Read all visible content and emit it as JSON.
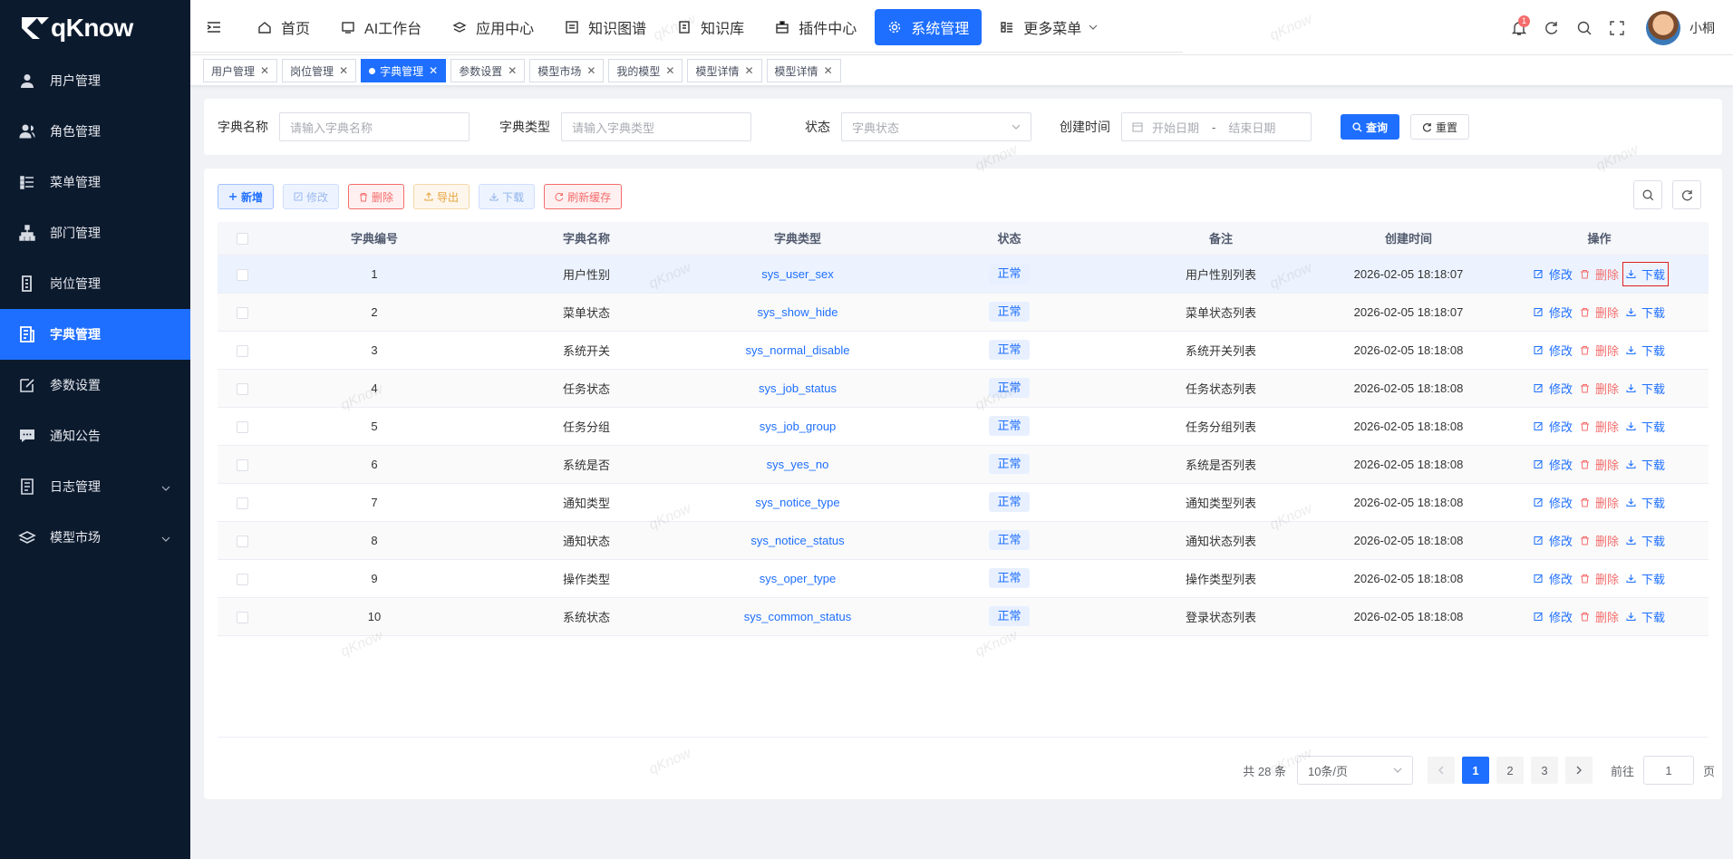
{
  "app": {
    "logo": "qKnow"
  },
  "sidebar": {
    "items": [
      {
        "label": "用户管理",
        "icon": "user-icon"
      },
      {
        "label": "角色管理",
        "icon": "role-icon"
      },
      {
        "label": "菜单管理",
        "icon": "menu-list-icon"
      },
      {
        "label": "部门管理",
        "icon": "org-tree-icon"
      },
      {
        "label": "岗位管理",
        "icon": "post-icon"
      },
      {
        "label": "字典管理",
        "icon": "dict-icon",
        "active": true
      },
      {
        "label": "参数设置",
        "icon": "edit-icon"
      },
      {
        "label": "通知公告",
        "icon": "message-icon"
      },
      {
        "label": "日志管理",
        "icon": "log-icon",
        "expandable": true
      },
      {
        "label": "模型市场",
        "icon": "model-icon",
        "expandable": true
      }
    ]
  },
  "topnav": {
    "items": [
      {
        "label": "首页",
        "icon": "home-icon"
      },
      {
        "label": "AI工作台",
        "icon": "ai-icon"
      },
      {
        "label": "应用中心",
        "icon": "app-icon"
      },
      {
        "label": "知识图谱",
        "icon": "graph-icon"
      },
      {
        "label": "知识库",
        "icon": "book-icon"
      },
      {
        "label": "插件中心",
        "icon": "plugin-icon"
      },
      {
        "label": "系统管理",
        "icon": "gear-icon",
        "active": true
      },
      {
        "label": "更多菜单",
        "icon": "more-icon"
      }
    ]
  },
  "header": {
    "notification_count": "1",
    "username": "小桐"
  },
  "tags": [
    {
      "label": "用户管理"
    },
    {
      "label": "岗位管理"
    },
    {
      "label": "字典管理",
      "active": true
    },
    {
      "label": "参数设置"
    },
    {
      "label": "模型市场"
    },
    {
      "label": "我的模型"
    },
    {
      "label": "模型详情"
    },
    {
      "label": "模型详情"
    }
  ],
  "search": {
    "dict_name_label": "字典名称",
    "dict_name_placeholder": "请输入字典名称",
    "dict_type_label": "字典类型",
    "dict_type_placeholder": "请输入字典类型",
    "status_label": "状态",
    "status_placeholder": "字典状态",
    "created_label": "创建时间",
    "start_placeholder": "开始日期",
    "range_sep": "-",
    "end_placeholder": "结束日期",
    "query_btn": "查询",
    "reset_btn": "重置"
  },
  "toolbar": {
    "add": "新增",
    "edit": "修改",
    "delete": "删除",
    "export": "导出",
    "download": "下载",
    "refresh_cache": "刷新缓存"
  },
  "table": {
    "columns": [
      "字典编号",
      "字典名称",
      "字典类型",
      "状态",
      "备注",
      "创建时间",
      "操作"
    ],
    "action_labels": {
      "edit": "修改",
      "delete": "删除",
      "download": "下载"
    },
    "rows": [
      {
        "id": "1",
        "name": "用户性别",
        "type": "sys_user_sex",
        "status": "正常",
        "remark": "用户性别列表",
        "created": "2026-02-05 18:18:07"
      },
      {
        "id": "2",
        "name": "菜单状态",
        "type": "sys_show_hide",
        "status": "正常",
        "remark": "菜单状态列表",
        "created": "2026-02-05 18:18:07"
      },
      {
        "id": "3",
        "name": "系统开关",
        "type": "sys_normal_disable",
        "status": "正常",
        "remark": "系统开关列表",
        "created": "2026-02-05 18:18:08"
      },
      {
        "id": "4",
        "name": "任务状态",
        "type": "sys_job_status",
        "status": "正常",
        "remark": "任务状态列表",
        "created": "2026-02-05 18:18:08"
      },
      {
        "id": "5",
        "name": "任务分组",
        "type": "sys_job_group",
        "status": "正常",
        "remark": "任务分组列表",
        "created": "2026-02-05 18:18:08"
      },
      {
        "id": "6",
        "name": "系统是否",
        "type": "sys_yes_no",
        "status": "正常",
        "remark": "系统是否列表",
        "created": "2026-02-05 18:18:08"
      },
      {
        "id": "7",
        "name": "通知类型",
        "type": "sys_notice_type",
        "status": "正常",
        "remark": "通知类型列表",
        "created": "2026-02-05 18:18:08"
      },
      {
        "id": "8",
        "name": "通知状态",
        "type": "sys_notice_status",
        "status": "正常",
        "remark": "通知状态列表",
        "created": "2026-02-05 18:18:08"
      },
      {
        "id": "9",
        "name": "操作类型",
        "type": "sys_oper_type",
        "status": "正常",
        "remark": "操作类型列表",
        "created": "2026-02-05 18:18:08"
      },
      {
        "id": "10",
        "name": "系统状态",
        "type": "sys_common_status",
        "status": "正常",
        "remark": "登录状态列表",
        "created": "2026-02-05 18:18:08"
      }
    ]
  },
  "pagination": {
    "total": "共 28 条",
    "page_size": "10条/页",
    "pages": [
      "1",
      "2",
      "3"
    ],
    "current": "1",
    "goto_label": "前往",
    "goto_value": "1",
    "page_suffix": "页"
  },
  "watermark": "qKnow",
  "colors": {
    "primary": "#1e6fff",
    "sidebar_bg": "#0c1a2e",
    "danger": "#f56c6c",
    "warning": "#e6a23c"
  }
}
